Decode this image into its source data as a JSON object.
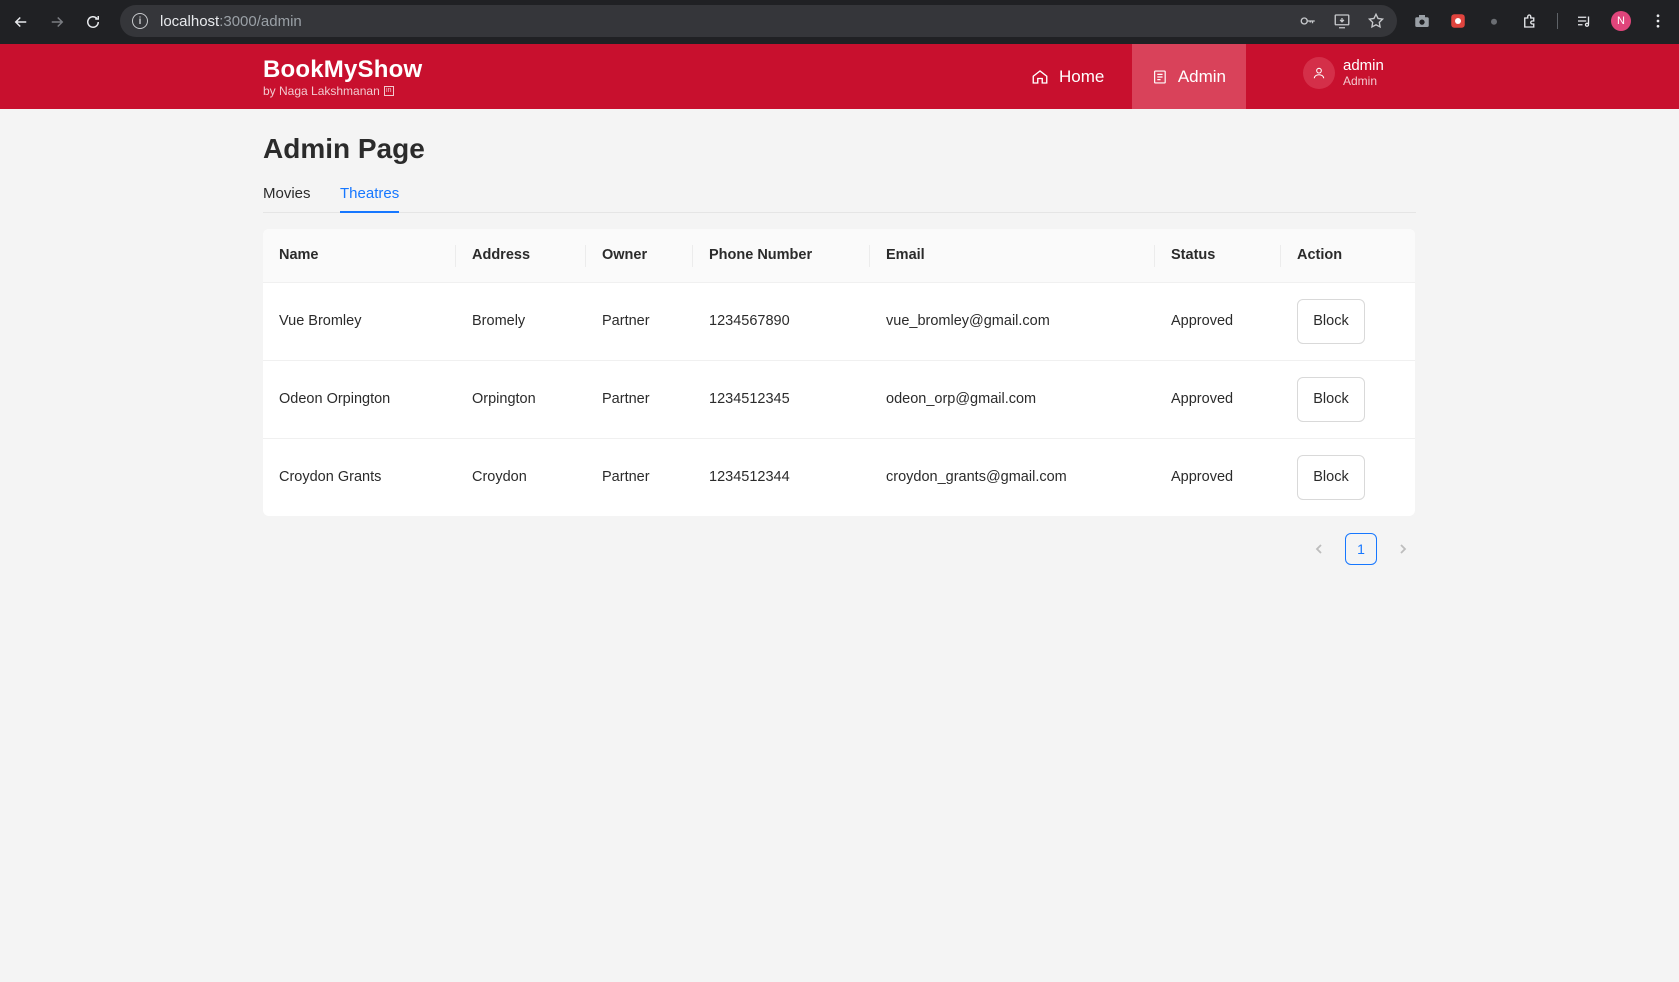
{
  "browser": {
    "url_host": "localhost",
    "url_path": ":3000/admin",
    "profile_initial": "N"
  },
  "header": {
    "brand_title": "BookMyShow",
    "brand_subtitle": "by Naga Lakshmanan",
    "brand_color": "#c8102e",
    "nav": [
      {
        "label": "Home",
        "icon": "home-icon"
      },
      {
        "label": "Admin",
        "icon": "admin-icon"
      }
    ],
    "user": {
      "name": "admin",
      "role": "Admin"
    }
  },
  "page": {
    "title": "Admin Page",
    "tabs": [
      {
        "label": "Movies",
        "active": false
      },
      {
        "label": "Theatres",
        "active": true
      }
    ]
  },
  "table": {
    "columns": [
      "Name",
      "Address",
      "Owner",
      "Phone Number",
      "Email",
      "Status",
      "Action"
    ],
    "rows": [
      {
        "name": "Vue Bromley",
        "address": "Bromely",
        "owner": "Partner",
        "phone": "1234567890",
        "email": "vue_bromley@gmail.com",
        "status": "Approved",
        "action": "Block"
      },
      {
        "name": "Odeon Orpington",
        "address": "Orpington",
        "owner": "Partner",
        "phone": "1234512345",
        "email": "odeon_orp@gmail.com",
        "status": "Approved",
        "action": "Block"
      },
      {
        "name": "Croydon Grants",
        "address": "Croydon",
        "owner": "Partner",
        "phone": "1234512344",
        "email": "croydon_grants@gmail.com",
        "status": "Approved",
        "action": "Block"
      }
    ]
  },
  "pagination": {
    "current": "1"
  }
}
